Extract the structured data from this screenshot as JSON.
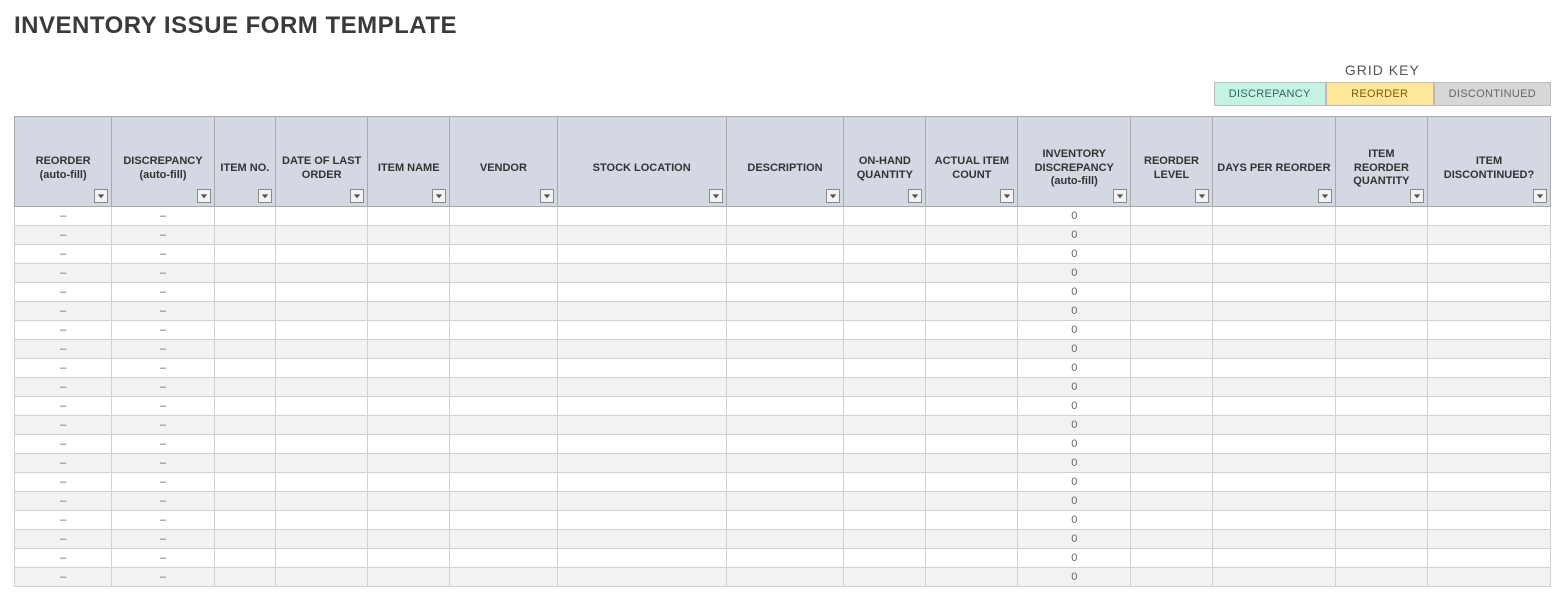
{
  "title": "INVENTORY ISSUE FORM TEMPLATE",
  "legend": {
    "heading": "GRID KEY",
    "items": [
      {
        "label": "DISCREPANCY",
        "className": "leg-discrepancy"
      },
      {
        "label": "REORDER",
        "className": "leg-reorder"
      },
      {
        "label": "DISCONTINUED",
        "className": "leg-discontinued"
      }
    ]
  },
  "columns": [
    {
      "key": "reorder_auto",
      "label": "REORDER (auto-fill)",
      "colClass": "c-reorder"
    },
    {
      "key": "discrepancy_auto",
      "label": "DISCREPANCY (auto-fill)",
      "colClass": "c-discrepancy"
    },
    {
      "key": "item_no",
      "label": "ITEM NO.",
      "colClass": "c-itemno"
    },
    {
      "key": "date_last_order",
      "label": "DATE OF LAST ORDER",
      "colClass": "c-date"
    },
    {
      "key": "item_name",
      "label": "ITEM NAME",
      "colClass": "c-itemname"
    },
    {
      "key": "vendor",
      "label": "VENDOR",
      "colClass": "c-vendor"
    },
    {
      "key": "stock_location",
      "label": "STOCK LOCATION",
      "colClass": "c-stockloc"
    },
    {
      "key": "description",
      "label": "DESCRIPTION",
      "colClass": "c-desc"
    },
    {
      "key": "on_hand_qty",
      "label": "ON-HAND QUANTITY",
      "colClass": "c-onhand"
    },
    {
      "key": "actual_item_count",
      "label": "ACTUAL ITEM COUNT",
      "colClass": "c-actual"
    },
    {
      "key": "inv_discrepancy",
      "label": "INVENTORY DISCREPANCY (auto-fill)",
      "colClass": "c-invdisc"
    },
    {
      "key": "reorder_level",
      "label": "REORDER LEVEL",
      "colClass": "c-reorderlvl"
    },
    {
      "key": "days_per_reorder",
      "label": "DAYS PER REORDER",
      "colClass": "c-daysper"
    },
    {
      "key": "item_reorder_qty",
      "label": "ITEM REORDER QUANTITY",
      "colClass": "c-reorderqty"
    },
    {
      "key": "item_discontinued",
      "label": "ITEM DISCONTINUED?",
      "colClass": "c-discontinued"
    }
  ],
  "rows": [
    {
      "reorder_auto": "–",
      "discrepancy_auto": "–",
      "item_no": "",
      "date_last_order": "",
      "item_name": "",
      "vendor": "",
      "stock_location": "",
      "description": "",
      "on_hand_qty": "",
      "actual_item_count": "",
      "inv_discrepancy": "0",
      "reorder_level": "",
      "days_per_reorder": "",
      "item_reorder_qty": "",
      "item_discontinued": ""
    },
    {
      "reorder_auto": "–",
      "discrepancy_auto": "–",
      "item_no": "",
      "date_last_order": "",
      "item_name": "",
      "vendor": "",
      "stock_location": "",
      "description": "",
      "on_hand_qty": "",
      "actual_item_count": "",
      "inv_discrepancy": "0",
      "reorder_level": "",
      "days_per_reorder": "",
      "item_reorder_qty": "",
      "item_discontinued": ""
    },
    {
      "reorder_auto": "–",
      "discrepancy_auto": "–",
      "item_no": "",
      "date_last_order": "",
      "item_name": "",
      "vendor": "",
      "stock_location": "",
      "description": "",
      "on_hand_qty": "",
      "actual_item_count": "",
      "inv_discrepancy": "0",
      "reorder_level": "",
      "days_per_reorder": "",
      "item_reorder_qty": "",
      "item_discontinued": ""
    },
    {
      "reorder_auto": "–",
      "discrepancy_auto": "–",
      "item_no": "",
      "date_last_order": "",
      "item_name": "",
      "vendor": "",
      "stock_location": "",
      "description": "",
      "on_hand_qty": "",
      "actual_item_count": "",
      "inv_discrepancy": "0",
      "reorder_level": "",
      "days_per_reorder": "",
      "item_reorder_qty": "",
      "item_discontinued": ""
    },
    {
      "reorder_auto": "–",
      "discrepancy_auto": "–",
      "item_no": "",
      "date_last_order": "",
      "item_name": "",
      "vendor": "",
      "stock_location": "",
      "description": "",
      "on_hand_qty": "",
      "actual_item_count": "",
      "inv_discrepancy": "0",
      "reorder_level": "",
      "days_per_reorder": "",
      "item_reorder_qty": "",
      "item_discontinued": ""
    },
    {
      "reorder_auto": "–",
      "discrepancy_auto": "–",
      "item_no": "",
      "date_last_order": "",
      "item_name": "",
      "vendor": "",
      "stock_location": "",
      "description": "",
      "on_hand_qty": "",
      "actual_item_count": "",
      "inv_discrepancy": "0",
      "reorder_level": "",
      "days_per_reorder": "",
      "item_reorder_qty": "",
      "item_discontinued": ""
    },
    {
      "reorder_auto": "–",
      "discrepancy_auto": "–",
      "item_no": "",
      "date_last_order": "",
      "item_name": "",
      "vendor": "",
      "stock_location": "",
      "description": "",
      "on_hand_qty": "",
      "actual_item_count": "",
      "inv_discrepancy": "0",
      "reorder_level": "",
      "days_per_reorder": "",
      "item_reorder_qty": "",
      "item_discontinued": ""
    },
    {
      "reorder_auto": "–",
      "discrepancy_auto": "–",
      "item_no": "",
      "date_last_order": "",
      "item_name": "",
      "vendor": "",
      "stock_location": "",
      "description": "",
      "on_hand_qty": "",
      "actual_item_count": "",
      "inv_discrepancy": "0",
      "reorder_level": "",
      "days_per_reorder": "",
      "item_reorder_qty": "",
      "item_discontinued": ""
    },
    {
      "reorder_auto": "–",
      "discrepancy_auto": "–",
      "item_no": "",
      "date_last_order": "",
      "item_name": "",
      "vendor": "",
      "stock_location": "",
      "description": "",
      "on_hand_qty": "",
      "actual_item_count": "",
      "inv_discrepancy": "0",
      "reorder_level": "",
      "days_per_reorder": "",
      "item_reorder_qty": "",
      "item_discontinued": ""
    },
    {
      "reorder_auto": "–",
      "discrepancy_auto": "–",
      "item_no": "",
      "date_last_order": "",
      "item_name": "",
      "vendor": "",
      "stock_location": "",
      "description": "",
      "on_hand_qty": "",
      "actual_item_count": "",
      "inv_discrepancy": "0",
      "reorder_level": "",
      "days_per_reorder": "",
      "item_reorder_qty": "",
      "item_discontinued": ""
    },
    {
      "reorder_auto": "–",
      "discrepancy_auto": "–",
      "item_no": "",
      "date_last_order": "",
      "item_name": "",
      "vendor": "",
      "stock_location": "",
      "description": "",
      "on_hand_qty": "",
      "actual_item_count": "",
      "inv_discrepancy": "0",
      "reorder_level": "",
      "days_per_reorder": "",
      "item_reorder_qty": "",
      "item_discontinued": ""
    },
    {
      "reorder_auto": "–",
      "discrepancy_auto": "–",
      "item_no": "",
      "date_last_order": "",
      "item_name": "",
      "vendor": "",
      "stock_location": "",
      "description": "",
      "on_hand_qty": "",
      "actual_item_count": "",
      "inv_discrepancy": "0",
      "reorder_level": "",
      "days_per_reorder": "",
      "item_reorder_qty": "",
      "item_discontinued": ""
    },
    {
      "reorder_auto": "–",
      "discrepancy_auto": "–",
      "item_no": "",
      "date_last_order": "",
      "item_name": "",
      "vendor": "",
      "stock_location": "",
      "description": "",
      "on_hand_qty": "",
      "actual_item_count": "",
      "inv_discrepancy": "0",
      "reorder_level": "",
      "days_per_reorder": "",
      "item_reorder_qty": "",
      "item_discontinued": ""
    },
    {
      "reorder_auto": "–",
      "discrepancy_auto": "–",
      "item_no": "",
      "date_last_order": "",
      "item_name": "",
      "vendor": "",
      "stock_location": "",
      "description": "",
      "on_hand_qty": "",
      "actual_item_count": "",
      "inv_discrepancy": "0",
      "reorder_level": "",
      "days_per_reorder": "",
      "item_reorder_qty": "",
      "item_discontinued": ""
    },
    {
      "reorder_auto": "–",
      "discrepancy_auto": "–",
      "item_no": "",
      "date_last_order": "",
      "item_name": "",
      "vendor": "",
      "stock_location": "",
      "description": "",
      "on_hand_qty": "",
      "actual_item_count": "",
      "inv_discrepancy": "0",
      "reorder_level": "",
      "days_per_reorder": "",
      "item_reorder_qty": "",
      "item_discontinued": ""
    },
    {
      "reorder_auto": "–",
      "discrepancy_auto": "–",
      "item_no": "",
      "date_last_order": "",
      "item_name": "",
      "vendor": "",
      "stock_location": "",
      "description": "",
      "on_hand_qty": "",
      "actual_item_count": "",
      "inv_discrepancy": "0",
      "reorder_level": "",
      "days_per_reorder": "",
      "item_reorder_qty": "",
      "item_discontinued": ""
    },
    {
      "reorder_auto": "–",
      "discrepancy_auto": "–",
      "item_no": "",
      "date_last_order": "",
      "item_name": "",
      "vendor": "",
      "stock_location": "",
      "description": "",
      "on_hand_qty": "",
      "actual_item_count": "",
      "inv_discrepancy": "0",
      "reorder_level": "",
      "days_per_reorder": "",
      "item_reorder_qty": "",
      "item_discontinued": ""
    },
    {
      "reorder_auto": "–",
      "discrepancy_auto": "–",
      "item_no": "",
      "date_last_order": "",
      "item_name": "",
      "vendor": "",
      "stock_location": "",
      "description": "",
      "on_hand_qty": "",
      "actual_item_count": "",
      "inv_discrepancy": "0",
      "reorder_level": "",
      "days_per_reorder": "",
      "item_reorder_qty": "",
      "item_discontinued": ""
    },
    {
      "reorder_auto": "–",
      "discrepancy_auto": "–",
      "item_no": "",
      "date_last_order": "",
      "item_name": "",
      "vendor": "",
      "stock_location": "",
      "description": "",
      "on_hand_qty": "",
      "actual_item_count": "",
      "inv_discrepancy": "0",
      "reorder_level": "",
      "days_per_reorder": "",
      "item_reorder_qty": "",
      "item_discontinued": ""
    },
    {
      "reorder_auto": "–",
      "discrepancy_auto": "–",
      "item_no": "",
      "date_last_order": "",
      "item_name": "",
      "vendor": "",
      "stock_location": "",
      "description": "",
      "on_hand_qty": "",
      "actual_item_count": "",
      "inv_discrepancy": "0",
      "reorder_level": "",
      "days_per_reorder": "",
      "item_reorder_qty": "",
      "item_discontinued": ""
    }
  ]
}
